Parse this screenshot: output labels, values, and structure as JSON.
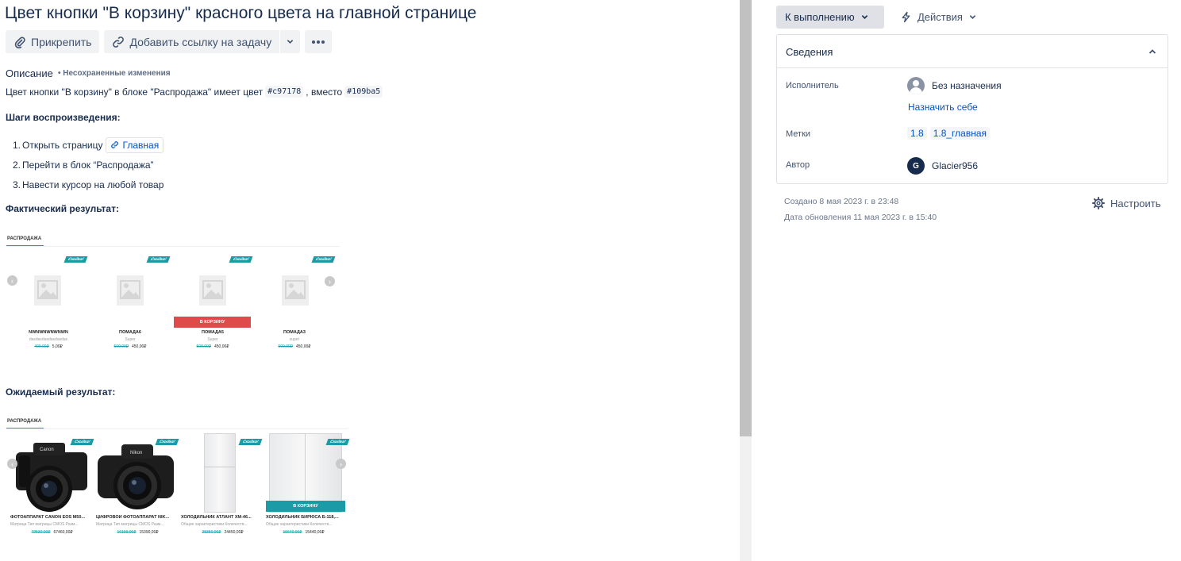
{
  "issue": {
    "title": "Цвет кнопки \"В корзину\" красного цвета на главной странице"
  },
  "toolbar": {
    "attach_label": "Прикрепить",
    "add_link_label": "Добавить ссылку на задачу",
    "paperclip_icon": "paperclip-icon",
    "link_icon": "link-icon"
  },
  "description": {
    "label": "Описание",
    "unsaved": "• Несохраненные изменения",
    "text_before": "Цвет кнопки \"В корзину\" в блоке \"Распродажа\" имеет цвет",
    "code1": "#c97178",
    "text_mid": ", вместо",
    "code2": "#109ba5"
  },
  "steps_heading": "Шаги воспроизведения:",
  "steps": [
    {
      "num": "1.",
      "text": "Открыть страницу",
      "link": "Главная"
    },
    {
      "num": "2.",
      "text": "Перейти в блок “Распродажа”"
    },
    {
      "num": "3.",
      "text": "Навести курсор на любой товар"
    }
  ],
  "actual_heading": "Фактический результат:",
  "expected_heading": "Ожидаемый результат:",
  "shot1": {
    "tab": "РАСПРОДАЖА",
    "badge": "Скидка!",
    "cart_button": "В КОРЗИНУ",
    "products": [
      {
        "name": "NWNWNWNWNWN",
        "sub": "dasdasdasdasdasdas",
        "old": "400,00₽",
        "price": "5,00₽"
      },
      {
        "name": "ПОМАДА6",
        "sub": "Super",
        "old": "500,00₽",
        "price": "450,00₽"
      },
      {
        "name": "ПОМАДА5",
        "sub": "Super",
        "old": "500,00₽",
        "price": "450,00₽"
      },
      {
        "name": "ПОМАДА3",
        "sub": "super",
        "old": "500,00₽",
        "price": "450,00₽"
      }
    ],
    "cart_color": "#df4a4a"
  },
  "shot2": {
    "tab": "РАСПРОДАЖА",
    "badge": "Скидка!",
    "cart_button": "В КОРЗИНУ",
    "products": [
      {
        "name": "ФОТОАППАРАТ CANON EOS M50...",
        "sub": "Матрица Тип матрицы CMOS Разм...",
        "old": "72530,00₽",
        "price": "67460,00₽"
      },
      {
        "name": "ЦИФРОВОЙ ФОТОАППАРАТ NIK...",
        "sub": "Матрица Тип матрицы CMOS Разм...",
        "old": "16199,00₽",
        "price": "15390,00₽"
      },
      {
        "name": "ХОЛОДИЛЬНИК АТЛАНТ ХМ-46...",
        "sub": "Общие характеристики Количеств...",
        "old": "28350,00₽",
        "price": "24450,00₽"
      },
      {
        "name": "ХОЛОДИЛЬНИК БИРЮСА Б-118,...",
        "sub": "Общие характеристики Количеств...",
        "old": "15640,00₽",
        "price": "15440,00₽"
      }
    ],
    "cart_color": "#1a9ba6",
    "cam1_brand": "Canon",
    "cam2_brand": "Nikon"
  },
  "sidebar": {
    "status_label": "К выполнению",
    "actions_label": "Действия",
    "panel_title": "Сведения",
    "assignee_label": "Исполнитель",
    "assignee_value": "Без назначения",
    "assign_me": "Назначить себе",
    "labels_label": "Метки",
    "labels": [
      "1.8",
      "1.8_главная"
    ],
    "reporter_label": "Автор",
    "reporter_initial": "G",
    "reporter_name": "Glacier956",
    "created": "Создано 8 мая 2023 г. в 23:48",
    "updated": "Дата обновления 11 мая 2023 г. в 15:40",
    "configure_label": "Настроить"
  },
  "colors": {
    "link": "#0052cc",
    "text": "#172b4d",
    "status_bg": "#dfe1e6"
  }
}
